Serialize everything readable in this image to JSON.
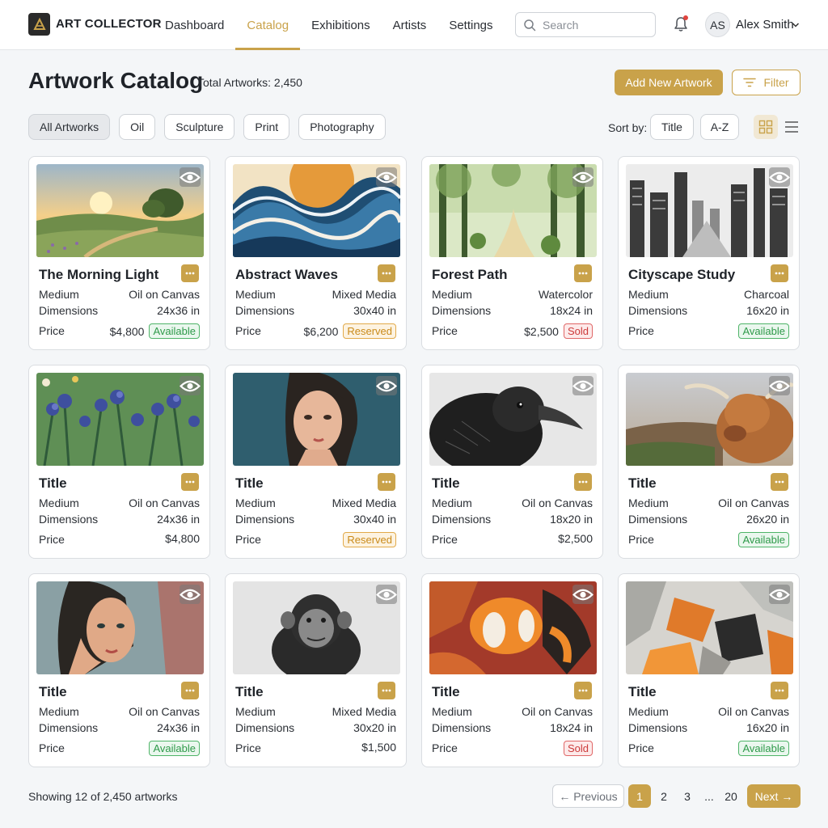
{
  "app": {
    "brand": "ART COLLECTOR",
    "nav": [
      "Dashboard",
      "Catalog",
      "Exhibitions",
      "Artists",
      "Settings"
    ],
    "active_nav": "Catalog",
    "search_placeholder": "Search",
    "user": {
      "initials": "AS",
      "name": "Alex Smith"
    }
  },
  "header": {
    "title": "Artwork Catalog",
    "total": "Total Artworks: 2,450",
    "add_label": "Add New Artwork",
    "filter_label": "Filter"
  },
  "filters": {
    "chips": [
      "All Artworks",
      "Oil",
      "Sculpture",
      "Print",
      "Photography"
    ],
    "active": "All Artworks",
    "sort_label": "Sort by:",
    "sort_options": [
      "Title",
      "A-Z"
    ]
  },
  "labels": {
    "medium": "Medium",
    "dimensions": "Dimensions",
    "price": "Price"
  },
  "artworks": [
    {
      "title": "The Morning Light",
      "medium": "Oil on Canvas",
      "dimensions": "24x36 in",
      "price": "$4,800",
      "status": "Available",
      "art": "landscape-sunrise"
    },
    {
      "title": "Abstract Waves",
      "medium": "Mixed Media",
      "dimensions": "30x40 in",
      "price": "$6,200",
      "status": "Reserved",
      "art": "waves"
    },
    {
      "title": "Forest Path",
      "medium": "Watercolor",
      "dimensions": "18x24 in",
      "price": "$2,500",
      "status": "Sold",
      "art": "forest"
    },
    {
      "title": "Cityscape Study",
      "medium": "Charcoal",
      "dimensions": "16x20 in",
      "price": "",
      "status": "Available",
      "art": "city"
    },
    {
      "title": "Title",
      "medium": "Oil on Canvas",
      "dimensions": "24x36 in",
      "price": "$4,800",
      "status": "",
      "art": "irises"
    },
    {
      "title": "Title",
      "medium": "Mixed Media",
      "dimensions": "30x40 in",
      "price": "",
      "status": "Reserved",
      "art": "portrait-woman"
    },
    {
      "title": "Title",
      "medium": "Oil on Canvas",
      "dimensions": "18x20 in",
      "price": "$2,500",
      "status": "",
      "art": "crow"
    },
    {
      "title": "Title",
      "medium": "Oil on Canvas",
      "dimensions": "26x20 in",
      "price": "",
      "status": "Available",
      "art": "highland-cow"
    },
    {
      "title": "Title",
      "medium": "Oil on Canvas",
      "dimensions": "24x36 in",
      "price": "",
      "status": "Available",
      "art": "portrait-painted"
    },
    {
      "title": "Title",
      "medium": "Mixed Media",
      "dimensions": "30x20 in",
      "price": "$1,500",
      "status": "",
      "art": "chimpanzee"
    },
    {
      "title": "Title",
      "medium": "Oil on Canvas",
      "dimensions": "18x24 in",
      "price": "",
      "status": "Sold",
      "art": "abstract-orange"
    },
    {
      "title": "Title",
      "medium": "Oil on Canvas",
      "dimensions": "16x20 in",
      "price": "",
      "status": "Available",
      "art": "abstract-geometric"
    }
  ],
  "footer": {
    "showing": "Showing 12 of 2,450 artworks",
    "prev_label": "← Previous",
    "pages": [
      "1",
      "2",
      "3",
      "...",
      "20"
    ],
    "active_page": "1",
    "next_label": "Next →"
  },
  "colors": {
    "accent": "#c9a24a",
    "available": "#2f9a4a",
    "reserved": "#c98a1a",
    "sold": "#cc3b3b"
  }
}
